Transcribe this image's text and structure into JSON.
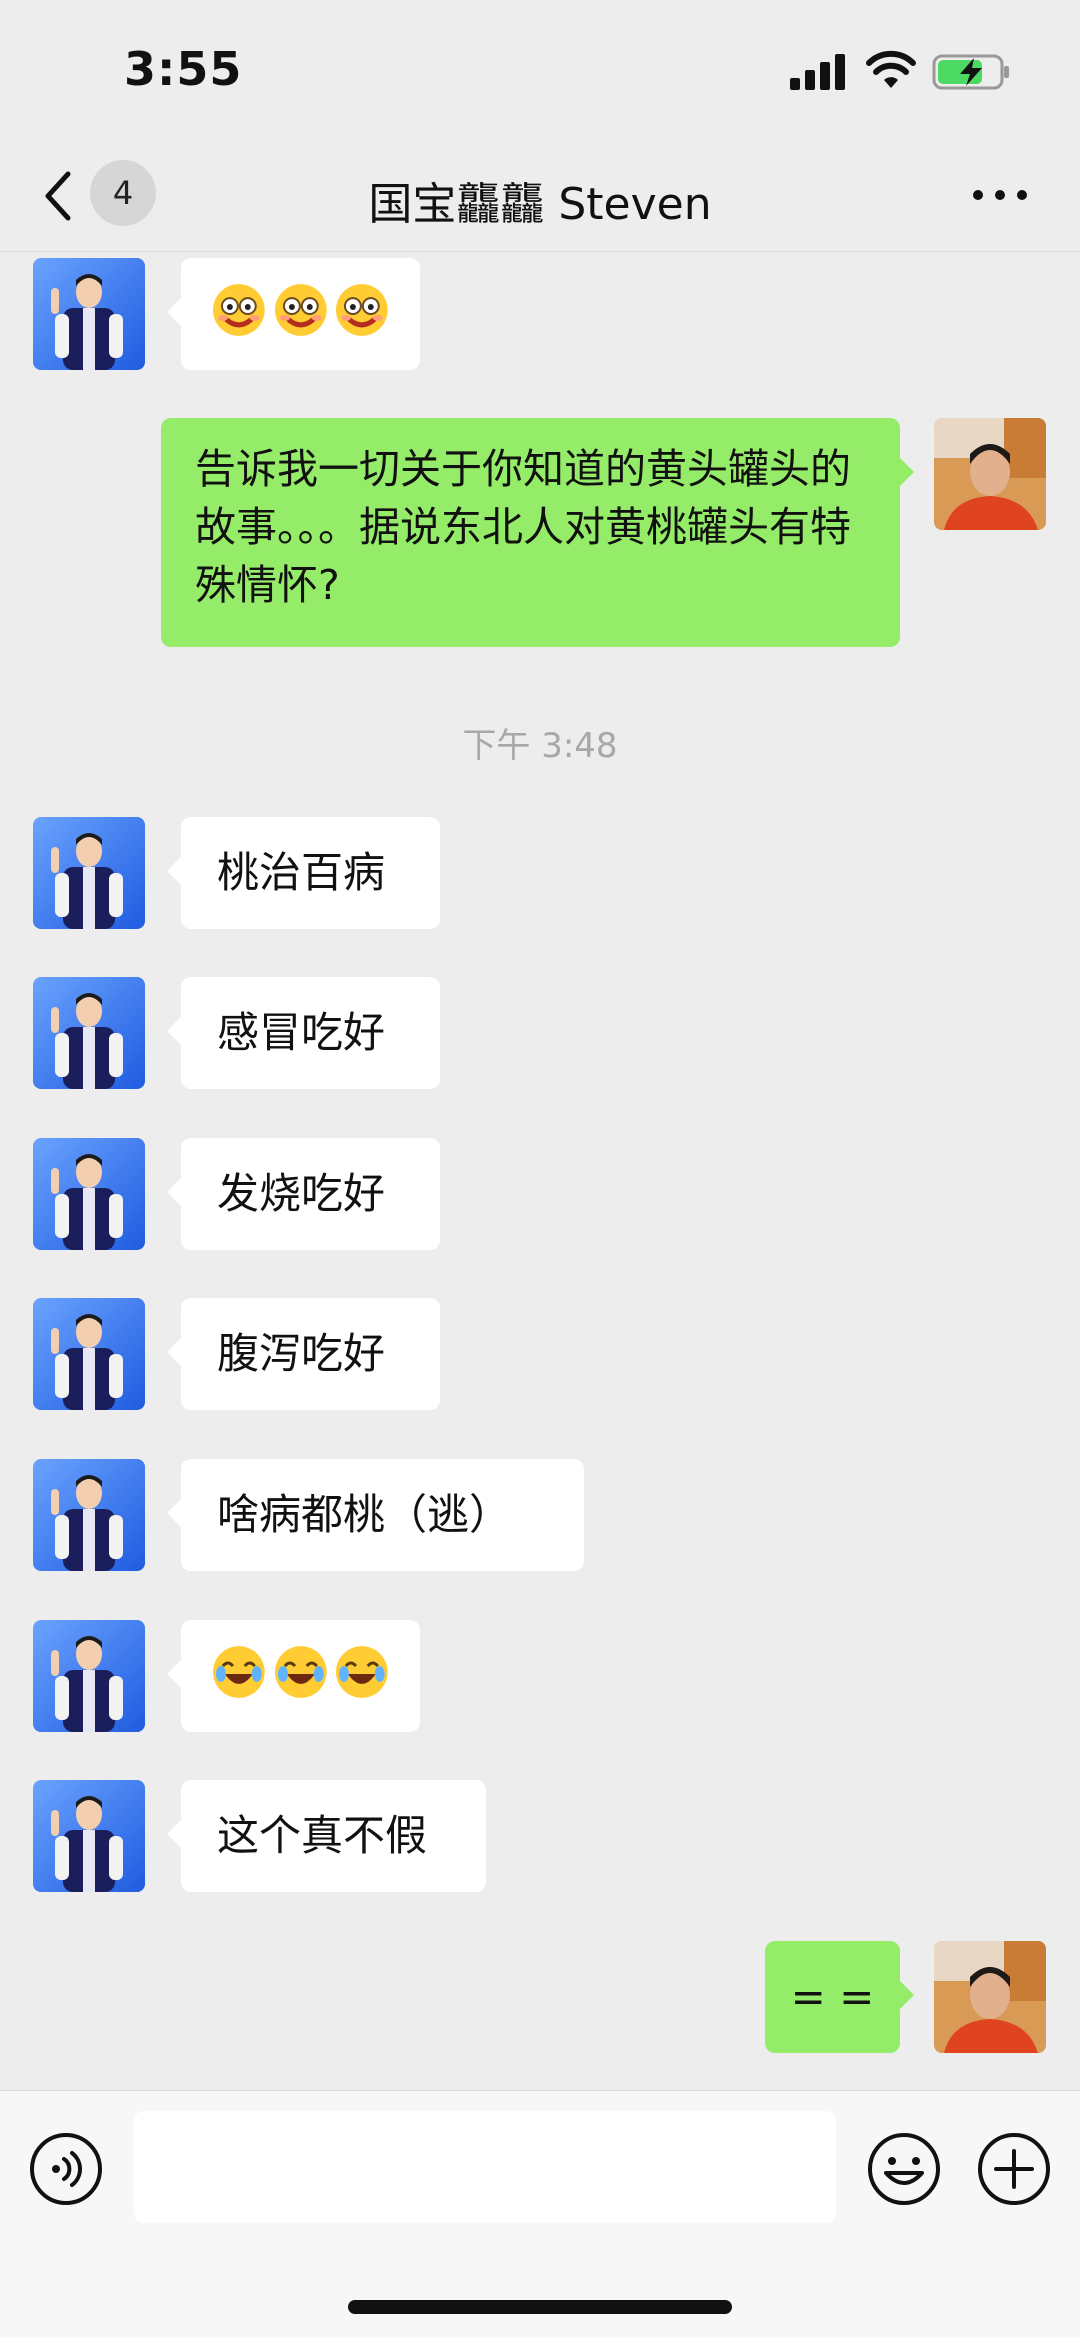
{
  "status_bar": {
    "time": "3:55"
  },
  "nav": {
    "unread_count": "4",
    "title": "国宝龘龘 Steven"
  },
  "messages": {
    "m1": {
      "from": "contact",
      "emoji": "smiling-face-emoji"
    },
    "m2": {
      "from": "me",
      "text": "告诉我一切关于你知道的黄头罐头的故事。。。据说东北人对黄桃罐头有特殊情怀?"
    },
    "timestamp": "下午 3:48",
    "m3": {
      "from": "contact",
      "text": "桃治百病"
    },
    "m4": {
      "from": "contact",
      "text": "感冒吃好"
    },
    "m5": {
      "from": "contact",
      "text": "发烧吃好"
    },
    "m6": {
      "from": "contact",
      "text": "腹泻吃好"
    },
    "m7": {
      "from": "contact",
      "text": "啥病都桃（逃）"
    },
    "m8": {
      "from": "contact",
      "emoji": "laughing-crying-emoji"
    },
    "m9": {
      "from": "contact",
      "text": "这个真不假"
    },
    "m10": {
      "from": "me",
      "text": "= ="
    }
  },
  "colors": {
    "outgoing_bubble": "#95ec69",
    "incoming_bubble": "#ffffff",
    "background": "#ededed",
    "battery_charging": "#4cd964"
  }
}
